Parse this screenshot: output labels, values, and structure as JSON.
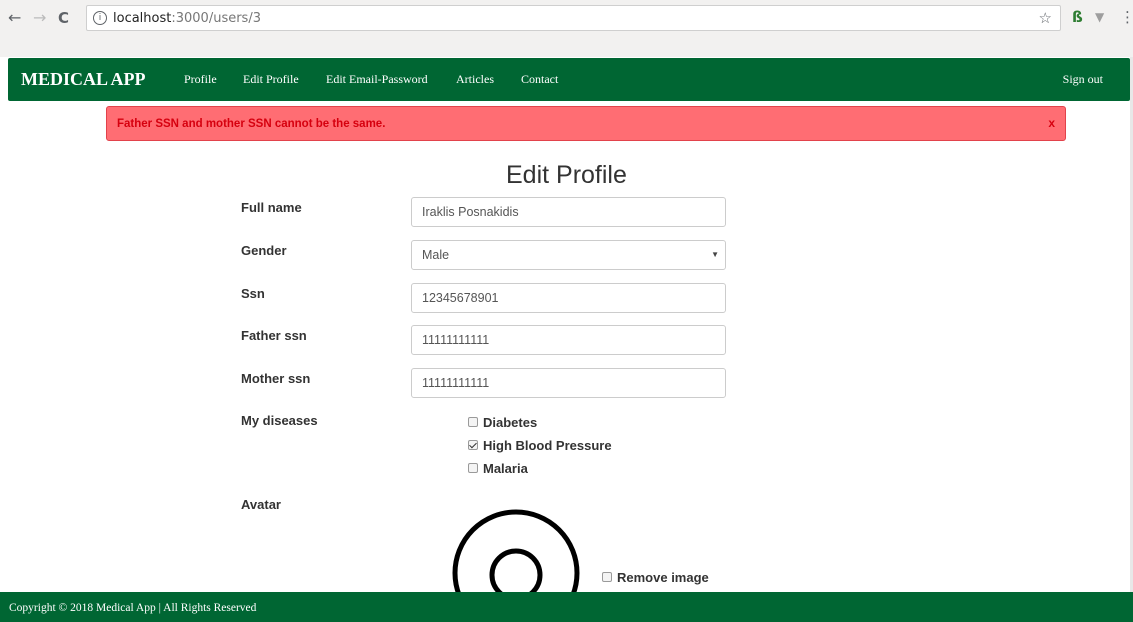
{
  "browser": {
    "url_host": "localhost",
    "url_path": ":3000/users/3",
    "info_glyph": "i",
    "back_glyph": "←",
    "forward_glyph": "→",
    "reload_glyph": "C",
    "star_glyph": "☆",
    "ext1_glyph": "ß",
    "ext2_glyph": "▼",
    "menu_glyph": "⋮"
  },
  "navbar": {
    "brand": "MEDICAL APP",
    "links": [
      "Profile",
      "Edit Profile",
      "Edit Email-Password",
      "Articles",
      "Contact"
    ],
    "sign_out": "Sign out",
    "color": "#006633"
  },
  "alert": {
    "message": "Father SSN and mother SSN cannot be the same.",
    "close": "x",
    "background": "#ff6d73",
    "text_color": "#d6000f"
  },
  "form": {
    "title": "Edit Profile",
    "full_name_label": "Full name",
    "full_name_value": "Iraklis Posnakidis",
    "gender_label": "Gender",
    "gender_value": "Male",
    "ssn_label": "Ssn",
    "ssn_value": "12345678901",
    "father_ssn_label": "Father ssn",
    "father_ssn_value": "11111111111",
    "mother_ssn_label": "Mother ssn",
    "mother_ssn_value": "11111111111",
    "diseases_label": "My diseases",
    "diseases": [
      {
        "label": "Diabetes",
        "checked": false
      },
      {
        "label": "High Blood Pressure",
        "checked": true
      },
      {
        "label": "Malaria",
        "checked": false
      }
    ],
    "avatar_label": "Avatar",
    "remove_image_label": "Remove image",
    "remove_image_checked": false
  },
  "footer": {
    "copyright": "Copyright © 2018 Medical App | All Rights Reserved"
  }
}
